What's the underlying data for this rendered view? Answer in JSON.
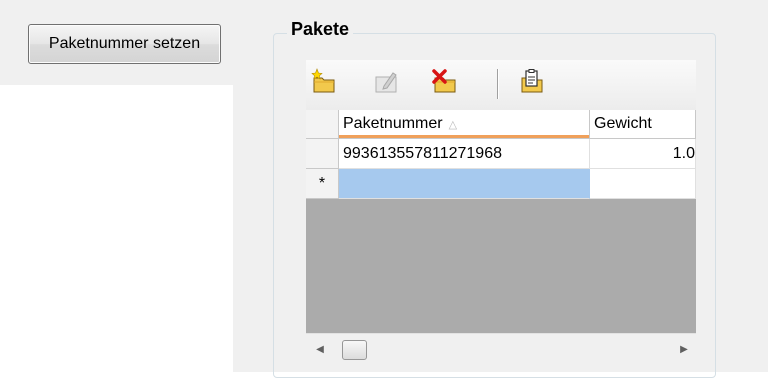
{
  "action_button": {
    "label": "Paketnummer setzen"
  },
  "group": {
    "title": "Pakete"
  },
  "toolbar": {
    "items": [
      {
        "icon": "add-record-icon"
      },
      {
        "icon": "edit-record-icon",
        "disabled": true
      },
      {
        "icon": "delete-record-icon"
      },
      {
        "icon": "clipboard-icon"
      }
    ]
  },
  "grid": {
    "columns": [
      {
        "label": "Paketnummer",
        "sort_indicator": "△"
      },
      {
        "label": "Gewicht"
      }
    ],
    "rows": [
      {
        "header": "",
        "paketnummer": "993613557811271968",
        "gewicht": "1.0"
      }
    ],
    "new_row": {
      "header": "*",
      "paketnummer": "",
      "gewicht": ""
    },
    "scrollbar": {
      "left_arrow": "◀",
      "right_arrow": "▶"
    }
  },
  "colors": {
    "selection": "#a6c9ee",
    "sort_underline": "#f0a05a",
    "empty_area": "#ababab"
  }
}
